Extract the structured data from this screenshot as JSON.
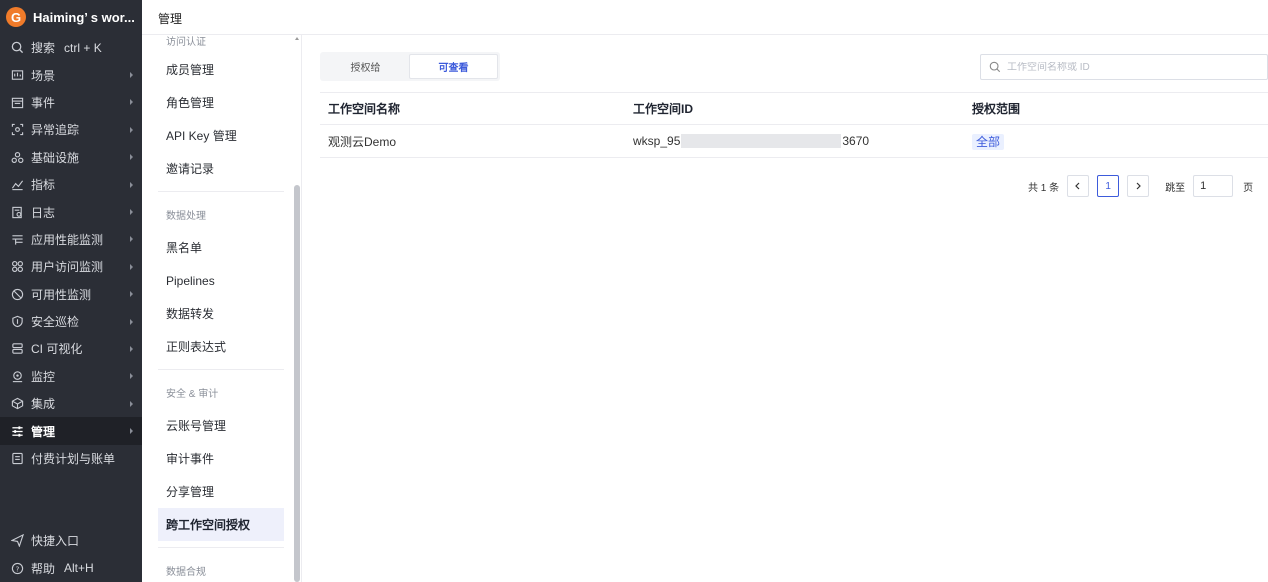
{
  "brand": {
    "name": "Haiming’ s wor..."
  },
  "sidebar": {
    "search": {
      "label": "搜索",
      "shortcut": "ctrl + K"
    },
    "items": [
      {
        "label": "场景",
        "icon": "dashboard-icon",
        "has_arrow": true
      },
      {
        "label": "事件",
        "icon": "calendar-icon",
        "has_arrow": true
      },
      {
        "label": "异常追踪",
        "icon": "target-icon",
        "has_arrow": true
      },
      {
        "label": "基础设施",
        "icon": "cluster-icon",
        "has_arrow": true
      },
      {
        "label": "指标",
        "icon": "metrics-icon",
        "has_arrow": true
      },
      {
        "label": "日志",
        "icon": "log-icon",
        "has_arrow": true
      },
      {
        "label": "应用性能监测",
        "icon": "apm-icon",
        "has_arrow": true
      },
      {
        "label": "用户访问监测",
        "icon": "rum-icon",
        "has_arrow": true
      },
      {
        "label": "可用性监测",
        "icon": "availability-icon",
        "has_arrow": true
      },
      {
        "label": "安全巡检",
        "icon": "shield-icon",
        "has_arrow": true
      },
      {
        "label": "CI 可视化",
        "icon": "ci-icon",
        "has_arrow": true
      },
      {
        "label": "监控",
        "icon": "monitor-icon",
        "has_arrow": true
      },
      {
        "label": "集成",
        "icon": "integration-icon",
        "has_arrow": true
      },
      {
        "label": "管理",
        "icon": "settings-sliders-icon",
        "has_arrow": true,
        "active": true
      },
      {
        "label": "付费计划与账单",
        "icon": "billing-icon",
        "has_arrow": false
      }
    ],
    "bottom": {
      "shortcut_entry": "快捷入口",
      "help": {
        "label": "帮助",
        "shortcut": "Alt+H"
      }
    }
  },
  "topbar": {
    "title": "管理"
  },
  "submenu": {
    "partial_top_label": "访问认证",
    "group1": [
      "成员管理",
      "角色管理",
      "API Key 管理",
      "邀请记录"
    ],
    "group2_title": "数据处理",
    "group2": [
      "黑名单",
      "Pipelines",
      "数据转发",
      "正则表达式"
    ],
    "group3_title": "安全 & 审计",
    "group3": [
      "云账号管理",
      "审计事件",
      "分享管理",
      "跨工作空间授权"
    ],
    "group4_title": "数据合规"
  },
  "main": {
    "tabs": [
      {
        "label": "授权给",
        "active": false
      },
      {
        "label": "可查看",
        "active": true
      }
    ],
    "search": {
      "placeholder": "工作空间名称或 ID",
      "value": ""
    },
    "table": {
      "columns": [
        "工作空间名称",
        "工作空间ID",
        "授权范围"
      ],
      "rows": [
        {
          "name": "观测云Demo",
          "id_prefix": "wksp_95",
          "id_suffix": "3670",
          "scope": "全部"
        }
      ]
    },
    "pagination": {
      "total": "共 1 条",
      "current_page": "1",
      "goto_label": "跳至",
      "goto_value": "1",
      "unit": "页"
    }
  },
  "colors": {
    "accent": "#3d5bdb",
    "sidebar_bg": "#2b2e36",
    "brand": "#f07b2a"
  }
}
